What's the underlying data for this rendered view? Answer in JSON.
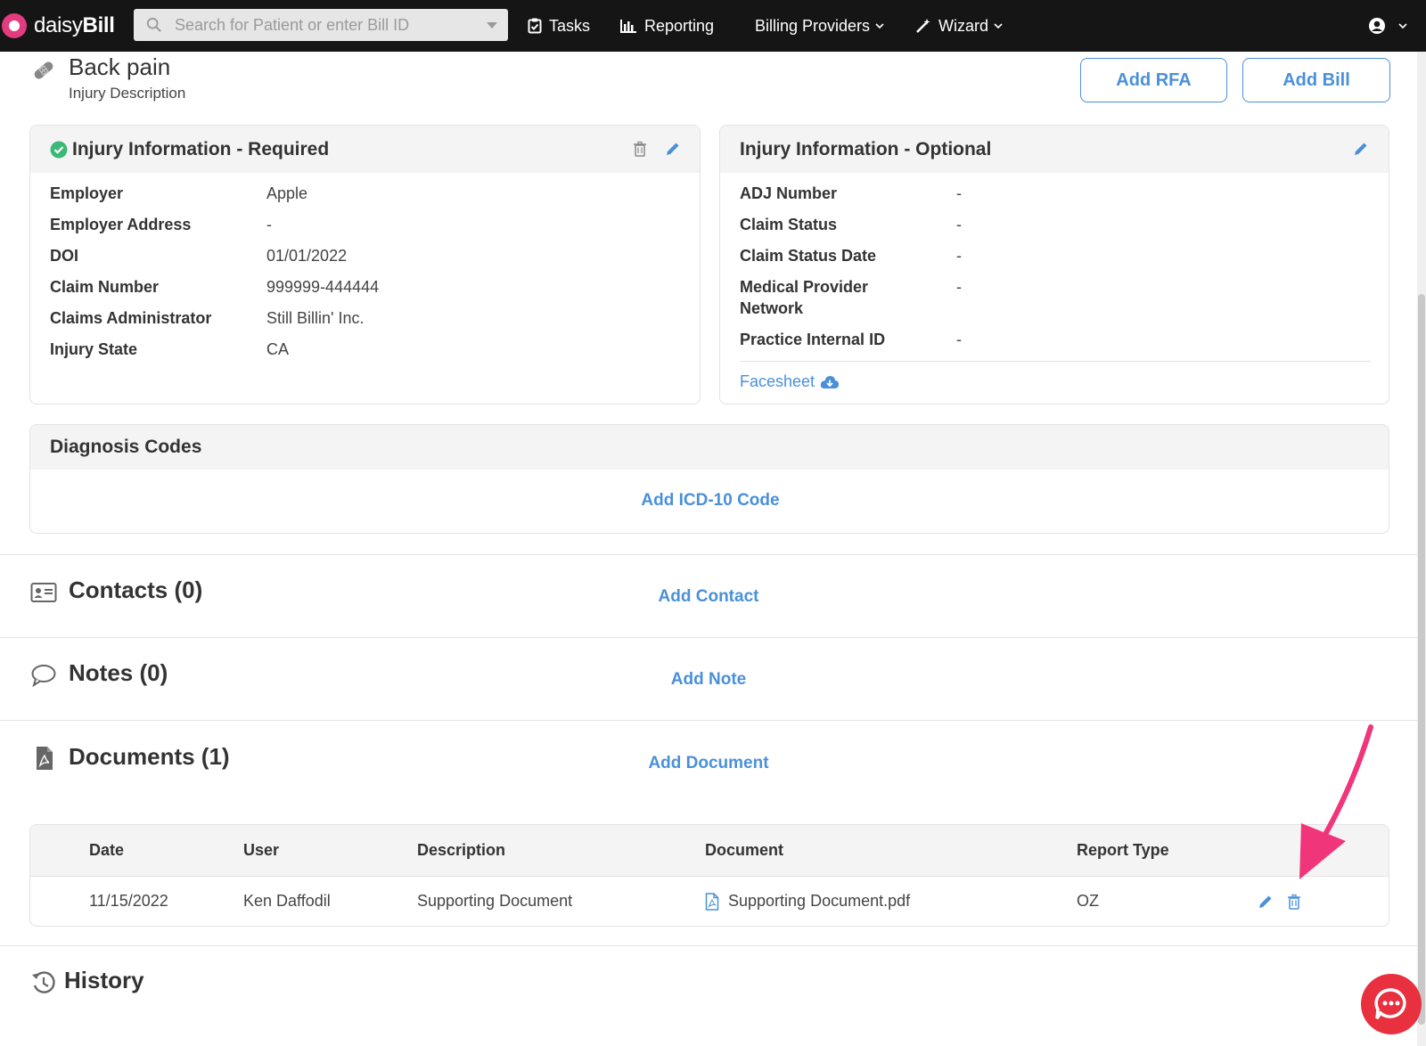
{
  "nav": {
    "logo_light": "daisy",
    "logo_bold": "Bill",
    "search_placeholder": "Search for Patient or enter Bill ID",
    "tasks": "Tasks",
    "reporting": "Reporting",
    "billing_providers": "Billing Providers",
    "wizard": "Wizard"
  },
  "header": {
    "title": "Back pain",
    "subtitle": "Injury Description",
    "add_rfa": "Add RFA",
    "add_bill": "Add Bill"
  },
  "injury_required": {
    "title": "Injury Information - Required",
    "rows": [
      {
        "label": "Employer",
        "value": "Apple"
      },
      {
        "label": "Employer Address",
        "value": "-"
      },
      {
        "label": "DOI",
        "value": "01/01/2022"
      },
      {
        "label": "Claim Number",
        "value": "999999-444444"
      },
      {
        "label": "Claims Administrator",
        "value": "Still Billin' Inc."
      },
      {
        "label": "Injury State",
        "value": "CA"
      }
    ]
  },
  "injury_optional": {
    "title": "Injury Information - Optional",
    "rows": [
      {
        "label": "ADJ Number",
        "value": "-"
      },
      {
        "label": "Claim Status",
        "value": "-"
      },
      {
        "label": "Claim Status Date",
        "value": "-"
      },
      {
        "label": "Medical Provider",
        "label2": "Network",
        "value": "-"
      },
      {
        "label": "Practice Internal ID",
        "value": "-"
      }
    ],
    "facesheet": "Facesheet"
  },
  "diagnosis": {
    "title": "Diagnosis Codes",
    "add": "Add ICD-10 Code"
  },
  "contacts": {
    "title": "Contacts (0)",
    "add": "Add Contact"
  },
  "notes": {
    "title": "Notes (0)",
    "add": "Add Note"
  },
  "documents": {
    "title": "Documents (1)",
    "add": "Add Document",
    "columns": [
      "Date",
      "User",
      "Description",
      "Document",
      "Report Type"
    ],
    "rows": [
      {
        "date": "11/15/2022",
        "user": "Ken Daffodil",
        "description": "Supporting Document",
        "document": "Supporting Document.pdf",
        "report_type": "OZ"
      }
    ]
  },
  "history": {
    "title": "History"
  },
  "colors": {
    "accent": "#4a90d9",
    "nav_bg": "#151515",
    "success": "#3cb878",
    "annotation_arrow": "#f0357a",
    "chat": "#e8303f"
  }
}
